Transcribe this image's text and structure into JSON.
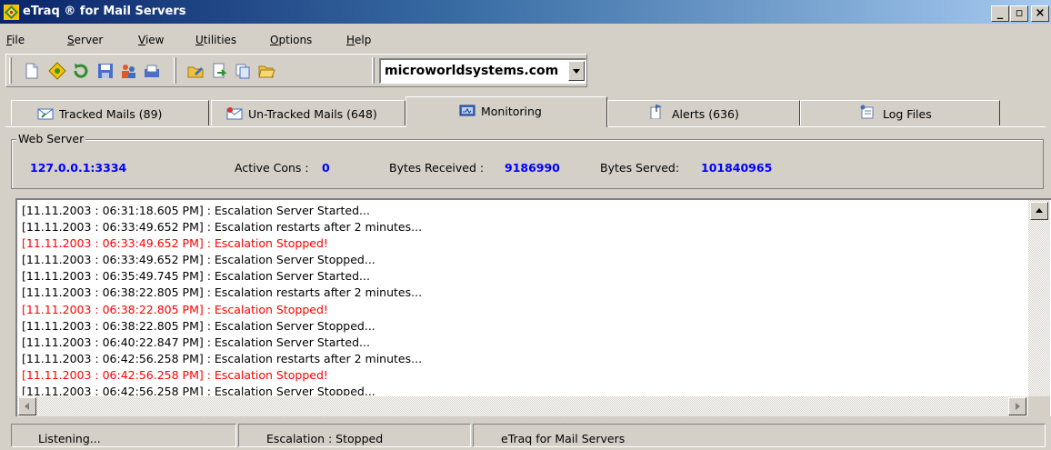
{
  "window": {
    "title": "eTraq ® for Mail Servers",
    "controls": {
      "minimize": "_",
      "maximize": "▫",
      "close": "×"
    }
  },
  "menu": {
    "items": [
      {
        "label": "File",
        "underline": "F"
      },
      {
        "label": "Server",
        "underline": "S"
      },
      {
        "label": "View",
        "underline": "V"
      },
      {
        "label": "Utilities",
        "underline": "U"
      },
      {
        "label": "Options",
        "underline": "O"
      },
      {
        "label": "Help",
        "underline": "H"
      }
    ]
  },
  "toolbar": {
    "icons": [
      "new-document-icon",
      "etraq-logo-icon",
      "refresh-arrow-icon",
      "save-disk-icon",
      "users-icon",
      "mail-tray-icon",
      "edit-folder-icon",
      "page-arrow-icon",
      "copy-icon",
      "open-folder-icon"
    ],
    "domain_combo": {
      "value": "microworldsystems.com"
    }
  },
  "tabs": [
    {
      "label": "Tracked Mails (89)",
      "icon": "tracked-mail-icon",
      "active": false
    },
    {
      "label": "Un-Tracked Mails (648)",
      "icon": "untracked-mail-icon",
      "active": false
    },
    {
      "label": "Monitoring",
      "icon": "monitor-icon",
      "active": true
    },
    {
      "label": "Alerts (636)",
      "icon": "alert-flag-icon",
      "active": false
    },
    {
      "label": "Log Files",
      "icon": "log-files-icon",
      "active": false
    }
  ],
  "web_server": {
    "legend": "Web Server",
    "address": "127.0.0.1:3334",
    "active_cons_label": "Active Cons :",
    "active_cons_value": "0",
    "bytes_received_label": "Bytes Received :",
    "bytes_received_value": "9186990",
    "bytes_served_label": "Bytes Served:",
    "bytes_served_value": "101840965",
    "value_color": "#0000ff"
  },
  "log": {
    "error_color": "#ff0000",
    "lines": [
      {
        "text": "[11.11.2003 : 06:31:18.605 PM] : Escalation Server Started...",
        "error": false
      },
      {
        "text": "[11.11.2003 : 06:33:49.652 PM] : Escalation restarts after 2 minutes...",
        "error": false
      },
      {
        "text": "[11.11.2003 : 06:33:49.652 PM] : Escalation Stopped!",
        "error": true
      },
      {
        "text": "[11.11.2003 : 06:33:49.652 PM] : Escalation Server Stopped...",
        "error": false
      },
      {
        "text": "[11.11.2003 : 06:35:49.745 PM] : Escalation Server Started...",
        "error": false
      },
      {
        "text": "[11.11.2003 : 06:38:22.805 PM] : Escalation restarts after 2 minutes...",
        "error": false
      },
      {
        "text": "[11.11.2003 : 06:38:22.805 PM] : Escalation Stopped!",
        "error": true
      },
      {
        "text": "[11.11.2003 : 06:38:22.805 PM] : Escalation Server Stopped...",
        "error": false
      },
      {
        "text": "[11.11.2003 : 06:40:22.847 PM] : Escalation Server Started...",
        "error": false
      },
      {
        "text": "[11.11.2003 : 06:42:56.258 PM] : Escalation restarts after 2 minutes...",
        "error": false
      },
      {
        "text": "[11.11.2003 : 06:42:56.258 PM] : Escalation Stopped!",
        "error": true
      },
      {
        "text": "[11.11.2003 : 06:42:56.258 PM] : Escalation Server Stopped...",
        "error": false
      }
    ]
  },
  "status_bar": {
    "listening": "Listening...",
    "escalation": "Escalation : Stopped",
    "app_name": "eTraq for Mail Servers"
  }
}
